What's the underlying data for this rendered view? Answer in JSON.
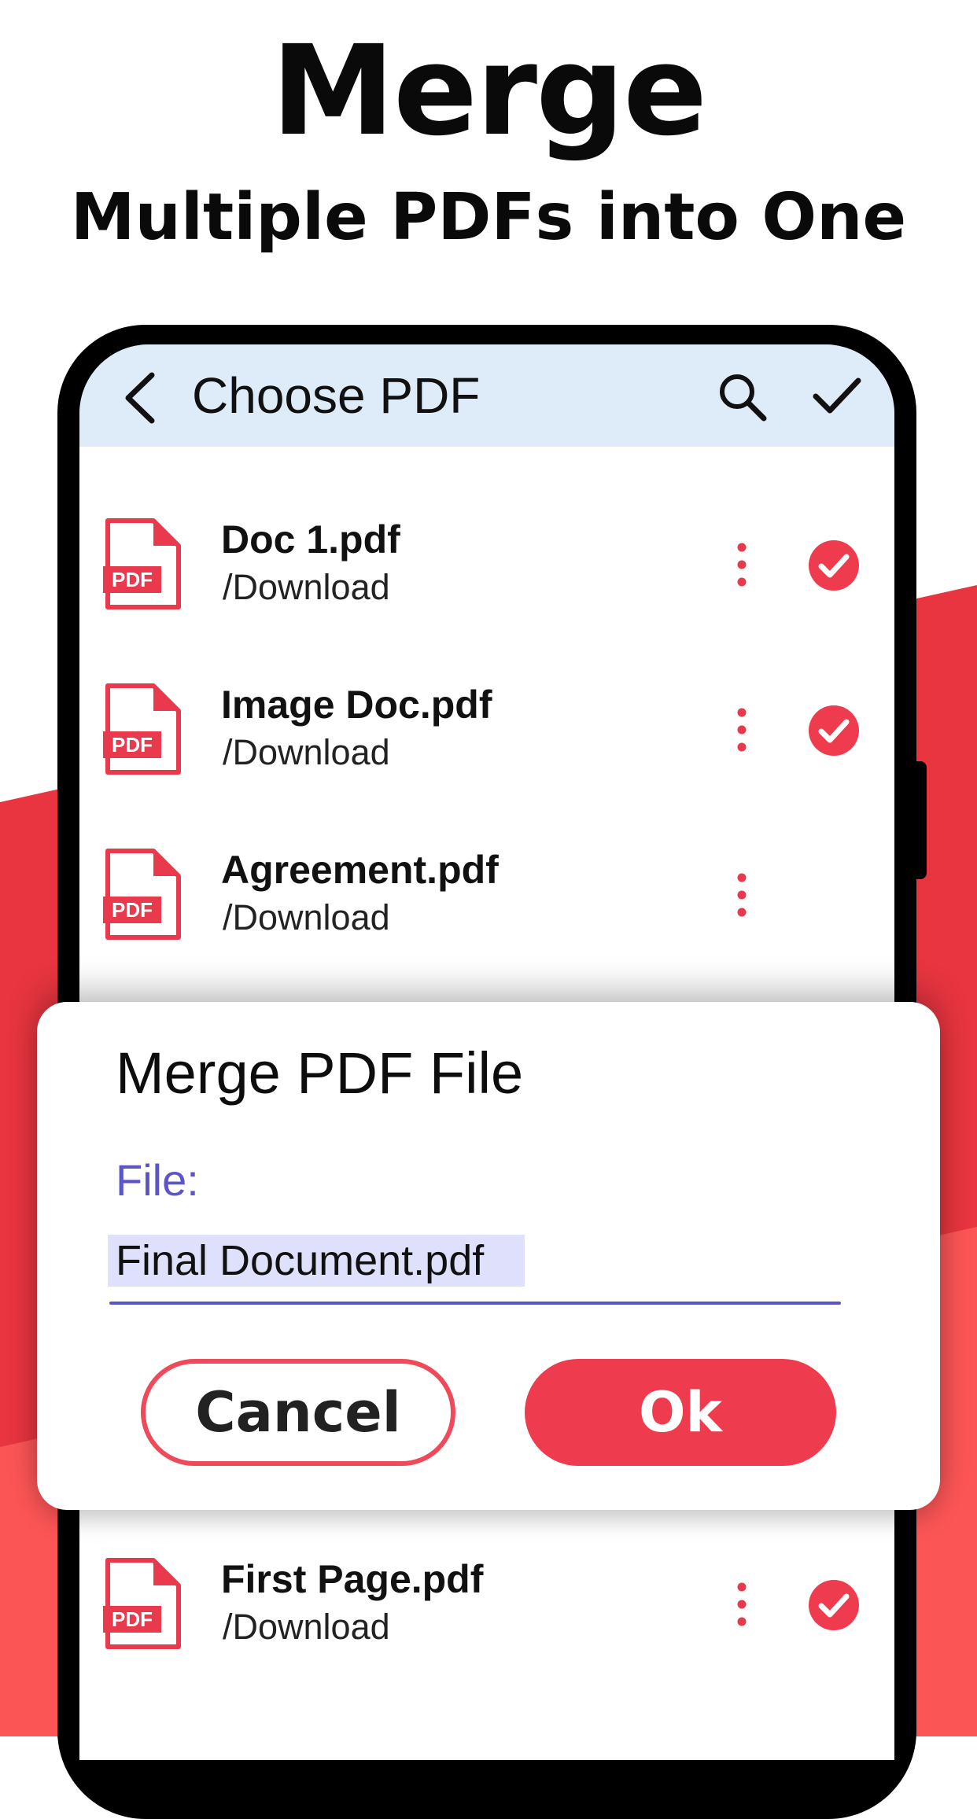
{
  "promo": {
    "title": "Merge",
    "subtitle": "Multiple PDFs into One"
  },
  "colors": {
    "accent_red": "#ee3b4e",
    "appbar_bg": "#deebf8",
    "field_purple": "#5b55c9"
  },
  "app_bar": {
    "title": "Choose PDF",
    "back_icon": "back-arrow-icon",
    "search_icon": "search-icon",
    "confirm_icon": "check-icon"
  },
  "files": [
    {
      "name": "Doc 1.pdf",
      "path": "/Download",
      "icon_label": "PDF",
      "selected": true
    },
    {
      "name": "Image Doc.pdf",
      "path": "/Download",
      "icon_label": "PDF",
      "selected": true
    },
    {
      "name": "Agreement.pdf",
      "path": "/Download",
      "icon_label": "PDF",
      "selected": false
    },
    {
      "name": "First Page.pdf",
      "path": "/Download",
      "icon_label": "PDF",
      "selected": true
    }
  ],
  "dialog": {
    "title": "Merge PDF File",
    "field_label": "File:",
    "file_value": "Final Document.pdf",
    "cancel_label": "Cancel",
    "ok_label": "Ok"
  }
}
